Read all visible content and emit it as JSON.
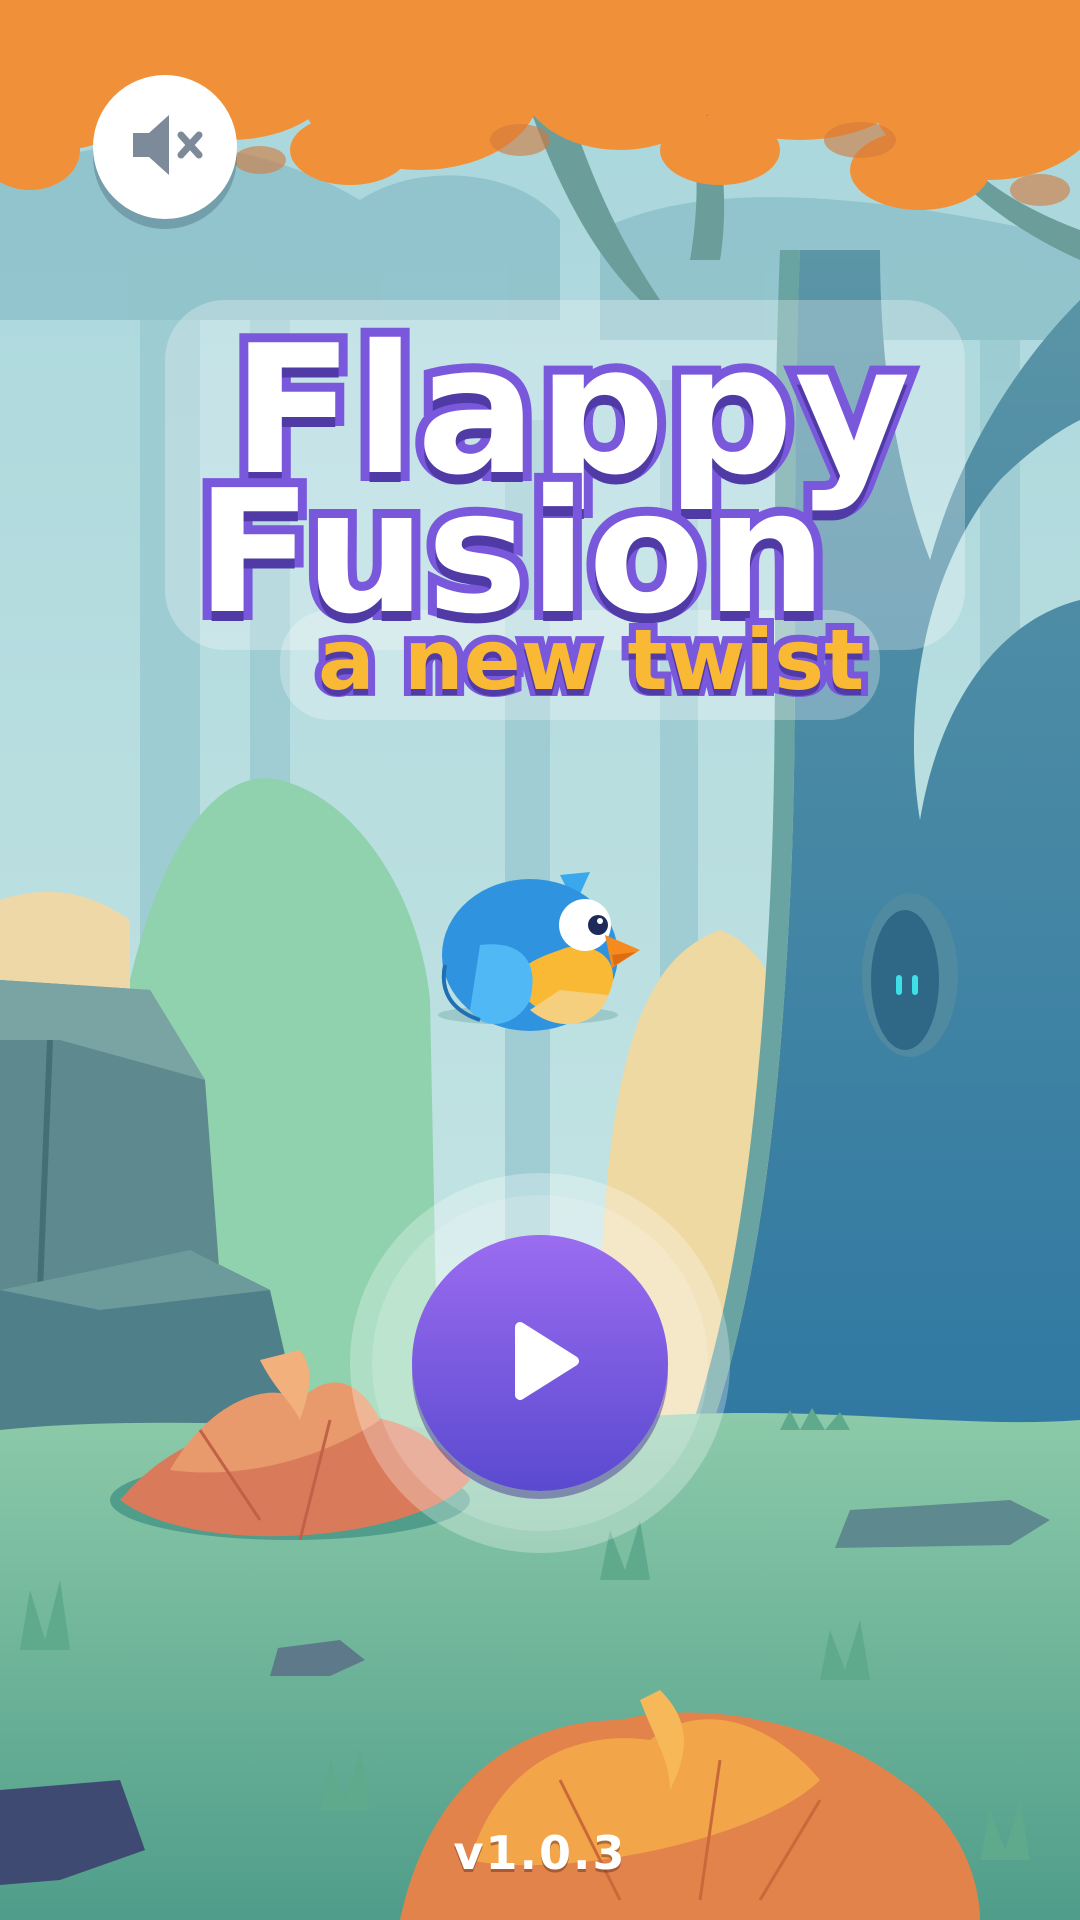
{
  "title": {
    "line1": "Flappy",
    "line2": "Fusion",
    "tagline": "a new twist"
  },
  "audio": {
    "icon": "speaker-muted-icon",
    "state": "muted"
  },
  "play": {
    "icon": "play-icon"
  },
  "footer": {
    "version": "v1.0.3"
  },
  "colors": {
    "title_fill": "#ffffff",
    "title_outline": "#7a58dc",
    "tagline_fill": "#f9b934",
    "play_button": "#7b5be6",
    "canopy": "#f0913a",
    "bird_body": "#2f93e0",
    "bird_belly": "#f9b934",
    "tree_trunk": "#3b7fa2",
    "grass": "#6db697"
  }
}
